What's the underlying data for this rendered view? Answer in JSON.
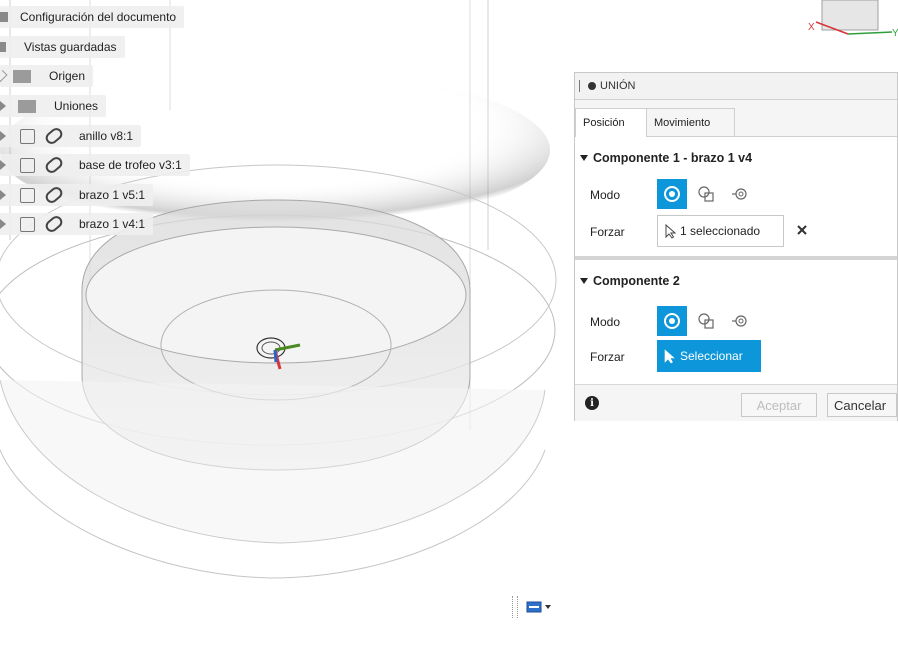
{
  "browser": {
    "items": [
      {
        "label": "Configuración del documento",
        "icon": "gear-icon"
      },
      {
        "label": "Vistas guardadas",
        "icon": "folder-icon"
      },
      {
        "label": "Origen",
        "icon": "folder-icon"
      },
      {
        "label": "Uniones",
        "icon": "folder-icon"
      },
      {
        "label": "anillo v8:1",
        "icon": "component-link-icon"
      },
      {
        "label": "base de trofeo v3:1",
        "icon": "component-link-icon"
      },
      {
        "label": "brazo 1 v5:1",
        "icon": "component-link-icon"
      },
      {
        "label": "brazo 1 v4:1",
        "icon": "component-link-icon"
      }
    ]
  },
  "viewcube": {
    "x_label": "X",
    "y_label": "Y"
  },
  "dialog": {
    "title": "UNIÓN",
    "tabs": [
      "Posición",
      "Movimiento"
    ],
    "active_tab": "Posición",
    "component1": {
      "title": "Componente 1 - brazo 1 v4",
      "mode_label": "Modo",
      "force_label": "Forzar",
      "selection_text": "1 seleccionado"
    },
    "component2": {
      "title": "Componente 2",
      "mode_label": "Modo",
      "force_label": "Forzar",
      "select_text": "Seleccionar"
    },
    "ok_label": "Aceptar",
    "cancel_label": "Cancelar"
  },
  "colors": {
    "accent": "#0d96d9",
    "axis_x": "#d9343a",
    "axis_y": "#2e9e3a",
    "axis_z": "#2e64c9"
  }
}
